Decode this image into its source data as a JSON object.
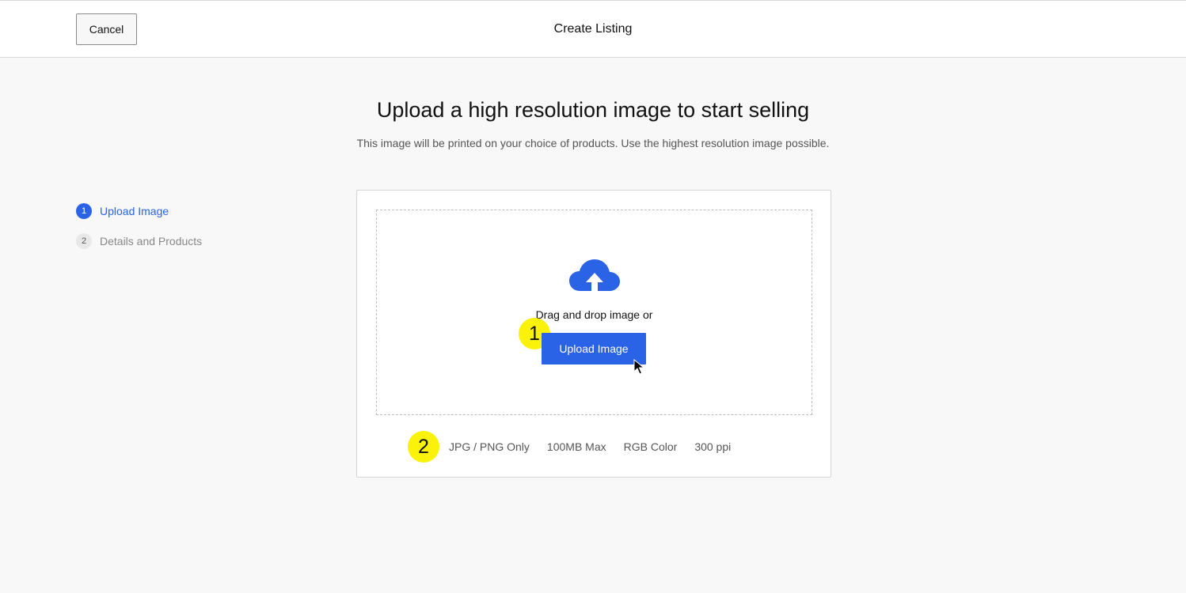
{
  "header": {
    "cancel_label": "Cancel",
    "title": "Create Listing"
  },
  "main": {
    "headline": "Upload a high resolution image to start selling",
    "subline": "This image will be printed on your choice of products. Use the highest resolution image possible."
  },
  "steps": [
    {
      "number": "1",
      "label": "Upload Image",
      "active": true
    },
    {
      "number": "2",
      "label": "Details and Products",
      "active": false
    }
  ],
  "upload": {
    "icon": "cloud-upload-icon",
    "drag_text": "Drag and drop image or",
    "button_label": "Upload Image"
  },
  "requirements": [
    "JPG / PNG Only",
    "100MB Max",
    "RGB Color",
    "300 ppi"
  ],
  "annotations": {
    "badge_1": "1",
    "badge_2": "2"
  },
  "colors": {
    "accent": "#2b63e6",
    "badge": "#fbf20a",
    "background": "#f8f8f8"
  }
}
